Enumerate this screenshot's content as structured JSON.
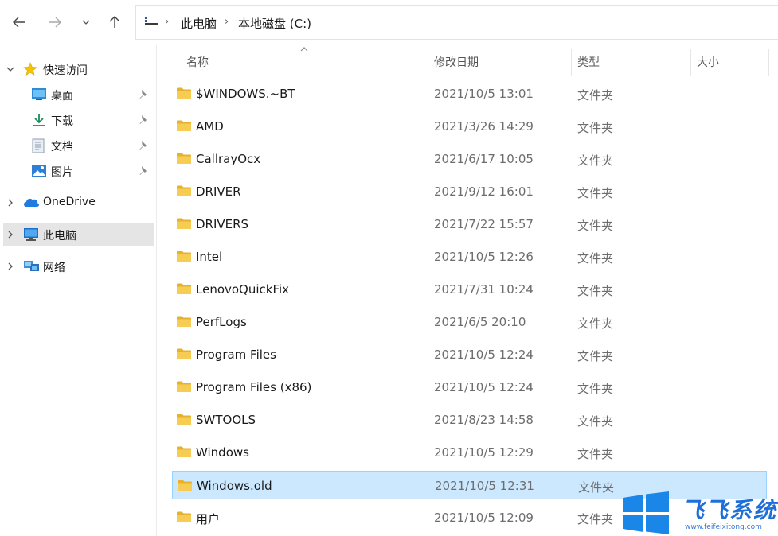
{
  "address_bar": {
    "crumbs": [
      "此电脑",
      "本地磁盘 (C:)"
    ]
  },
  "sidebar": {
    "items": [
      {
        "label": "快速访问",
        "icon": "star-icon",
        "expandable": true,
        "expanded": true
      },
      {
        "label": "桌面",
        "icon": "desktop-icon",
        "pinned": true
      },
      {
        "label": "下载",
        "icon": "download-icon",
        "pinned": true
      },
      {
        "label": "文档",
        "icon": "document-icon",
        "pinned": true
      },
      {
        "label": "图片",
        "icon": "pictures-icon",
        "pinned": true
      },
      {
        "label": "OneDrive",
        "icon": "cloud-icon",
        "expandable": true
      },
      {
        "label": "此电脑",
        "icon": "computer-icon",
        "expandable": true,
        "selected": true
      },
      {
        "label": "网络",
        "icon": "network-icon",
        "expandable": true
      }
    ]
  },
  "columns": {
    "name": "名称",
    "modified": "修改日期",
    "type": "类型",
    "size": "大小"
  },
  "files": [
    {
      "name": "$WINDOWS.~BT",
      "modified": "2021/10/5 13:01",
      "type": "文件夹"
    },
    {
      "name": "AMD",
      "modified": "2021/3/26 14:29",
      "type": "文件夹"
    },
    {
      "name": "CallrayOcx",
      "modified": "2021/6/17 10:05",
      "type": "文件夹"
    },
    {
      "name": "DRIVER",
      "modified": "2021/9/12 16:01",
      "type": "文件夹"
    },
    {
      "name": "DRIVERS",
      "modified": "2021/7/22 15:57",
      "type": "文件夹"
    },
    {
      "name": "Intel",
      "modified": "2021/10/5 12:26",
      "type": "文件夹"
    },
    {
      "name": "LenovoQuickFix",
      "modified": "2021/7/31 10:24",
      "type": "文件夹"
    },
    {
      "name": "PerfLogs",
      "modified": "2021/6/5 20:10",
      "type": "文件夹"
    },
    {
      "name": "Program Files",
      "modified": "2021/10/5 12:24",
      "type": "文件夹"
    },
    {
      "name": "Program Files (x86)",
      "modified": "2021/10/5 12:24",
      "type": "文件夹"
    },
    {
      "name": "SWTOOLS",
      "modified": "2021/8/23 14:58",
      "type": "文件夹"
    },
    {
      "name": "Windows",
      "modified": "2021/10/5 12:29",
      "type": "文件夹"
    },
    {
      "name": "Windows.old",
      "modified": "2021/10/5 12:31",
      "type": "文件夹",
      "selected": true
    },
    {
      "name": "用户",
      "modified": "2021/10/5 12:09",
      "type": "文件夹"
    }
  ],
  "watermark": {
    "title": "飞飞系统",
    "url": "www.feifeixitong.com"
  },
  "colors": {
    "folder": "#f7cc52",
    "selection_bg": "#cce8ff",
    "selection_border": "#99d1ff",
    "sidebar_selected": "#e5e5e5",
    "accent": "#1e6fd9"
  }
}
